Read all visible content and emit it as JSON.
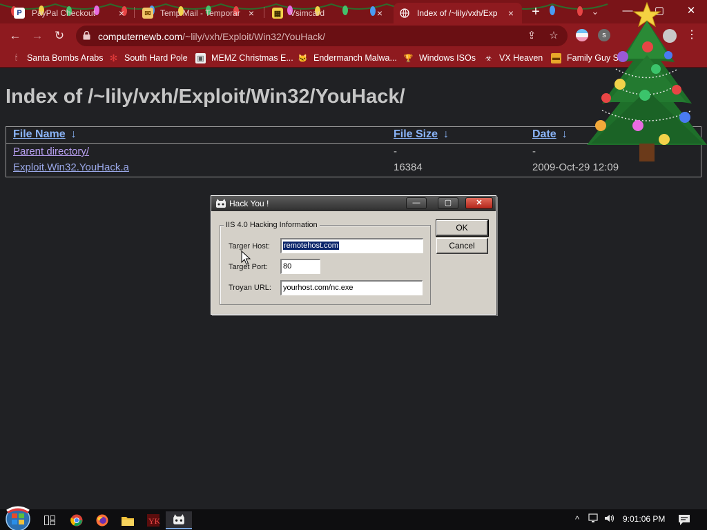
{
  "browser": {
    "tabs": [
      {
        "title": "PayPal Checkout",
        "icon": "paypal-icon",
        "active": false
      },
      {
        "title": "Temp Mail - Temporar",
        "icon": "mail-icon",
        "active": false
      },
      {
        "title": "Vsimcard",
        "icon": "sim-card-icon",
        "active": false
      },
      {
        "title": "Index of /~lily/vxh/Exp",
        "icon": "globe-icon",
        "active": true
      }
    ],
    "new_tab_label": "+",
    "tab_close_glyph": "×",
    "window_controls": {
      "minimize": "—",
      "maximize": "▢",
      "close": "✕"
    },
    "url": {
      "host": "computernewb.com",
      "path": "/~lily/vxh/Exploit/Win32/YouHack/"
    },
    "extension_label": "s",
    "bookmarks": [
      {
        "label": "Santa Bombs Arabs",
        "icon": "candle-icon"
      },
      {
        "label": "South Hard Pole",
        "icon": "snowflake-icon"
      },
      {
        "label": "MEMZ Christmas E...",
        "icon": "image-icon"
      },
      {
        "label": "Endermanch Malwa...",
        "icon": "cat-icon"
      },
      {
        "label": "Windows ISOs",
        "icon": "trophy-icon"
      },
      {
        "label": "VX Heaven",
        "icon": "virus-icon"
      },
      {
        "label": "Family Guy S",
        "icon": "folder-icon"
      }
    ],
    "accent": "#8e1a1f"
  },
  "page": {
    "title": "Index of /~lily/vxh/Exploit/Win32/YouHack/",
    "columns": [
      {
        "label": "File Name",
        "arrow": "↓"
      },
      {
        "label": "File Size",
        "arrow": "↓"
      },
      {
        "label": "Date",
        "arrow": "↓"
      }
    ],
    "rows": [
      {
        "name": "Parent directory/",
        "size": "-",
        "date": "-"
      },
      {
        "name": "Exploit.Win32.YouHack.a",
        "size": "16384",
        "date": "2009-Oct-29 12:09"
      }
    ],
    "link_color": "#9aa8e8"
  },
  "dialog": {
    "title": "Hack You !",
    "group_label": "IIS 4.0 Hacking Information",
    "fields": [
      {
        "label": "Targer Host:",
        "value": "remotehost.com",
        "selected": true
      },
      {
        "label": "Target Port:",
        "value": "80",
        "selected": false
      },
      {
        "label": "Troyan URL:",
        "value": "yourhost.com/nc.exe",
        "selected": false
      }
    ],
    "ok_label": "OK",
    "cancel_label": "Cancel",
    "window_controls": {
      "minimize": "—",
      "maximize": "▢",
      "close": "✕"
    }
  },
  "taskbar": {
    "apps": [
      "task-view-icon",
      "chrome-icon",
      "firefox-icon",
      "file-explorer-icon",
      "malware-app-icon",
      "hack-you-app-icon"
    ],
    "tray": {
      "chevron": "^",
      "volume": "🔊"
    },
    "clock": "9:01:06 PM"
  }
}
